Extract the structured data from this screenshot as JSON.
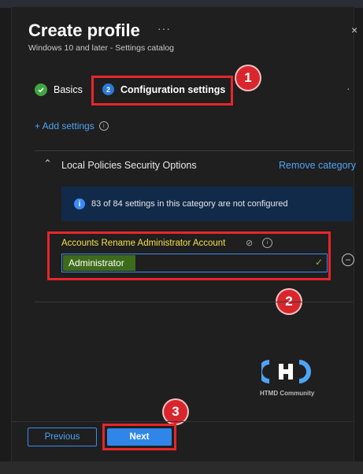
{
  "header": {
    "title": "Create profile",
    "more_glyph": "···",
    "subtitle": "Windows 10 and later - Settings catalog",
    "close_glyph": "×"
  },
  "steps": [
    {
      "label": "Basics",
      "state": "complete",
      "icon": "checkmark-icon"
    },
    {
      "number": "2",
      "label": "Configuration settings",
      "state": "active"
    }
  ],
  "add_settings": {
    "label": "+ Add settings"
  },
  "category": {
    "title": "Local Policies Security Options",
    "remove_label": "Remove category",
    "info_text": "83 of 84 settings in this category are not configured"
  },
  "setting": {
    "label": "Accounts Rename Administrator Account",
    "value": "Administrator"
  },
  "annotations": [
    "1",
    "2",
    "3"
  ],
  "watermark": "HTMD Community",
  "footer": {
    "previous_label": "Previous",
    "next_label": "Next"
  },
  "colors": {
    "accent": "#3d8af7",
    "annotation_red": "#e8252b",
    "success": "#3fa640"
  }
}
